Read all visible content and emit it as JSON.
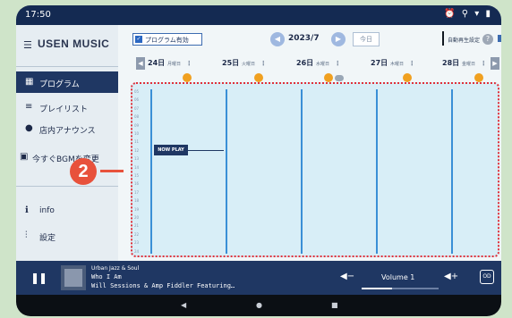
{
  "status": {
    "time": "17:50",
    "icons": "⏰ ⚲ ▾ ▮"
  },
  "sidebar": {
    "title": "USEN MUSIC",
    "items": [
      {
        "label": "プログラム",
        "icon": "grid-icon"
      },
      {
        "label": "プレイリスト",
        "icon": "playlist-icon"
      },
      {
        "label": "店内アナウンス",
        "icon": "speech-icon"
      },
      {
        "label": "今すぐBGMを変更",
        "icon": "shop-icon"
      },
      {
        "label": "info",
        "icon": "info-icon"
      },
      {
        "label": "設定",
        "icon": "sliders-icon"
      }
    ]
  },
  "toolbar": {
    "program_toggle": "プログラム有効",
    "month": "2023/7",
    "today": "今日",
    "setting_label": "自動再生設定"
  },
  "days": [
    {
      "date": "24日",
      "weekday": "月曜日"
    },
    {
      "date": "25日",
      "weekday": "火曜日"
    },
    {
      "date": "26日",
      "weekday": "水曜日"
    },
    {
      "date": "27日",
      "weekday": "木曜日"
    },
    {
      "date": "28日",
      "weekday": "金曜日"
    }
  ],
  "schedule": {
    "times": [
      "05",
      "06",
      "07",
      "08",
      "09",
      "10",
      "11",
      "12",
      "13",
      "14",
      "15",
      "16",
      "17",
      "18",
      "19",
      "20",
      "21",
      "22",
      "23",
      "24"
    ],
    "now_label": "NOW PLAY"
  },
  "callout": {
    "number": "2"
  },
  "player": {
    "channel": "Urban Jazz & Soul",
    "title": "Who I Am",
    "artist": "Will Sessions & Amp Fiddler Featuring…",
    "volume_label": "Volume 1",
    "volume_level": 0.4,
    "cast_label": "OD"
  },
  "colors": {
    "accent": "#1f3763",
    "callout": "#e8523c",
    "grid_line": "#3a8fd6"
  }
}
